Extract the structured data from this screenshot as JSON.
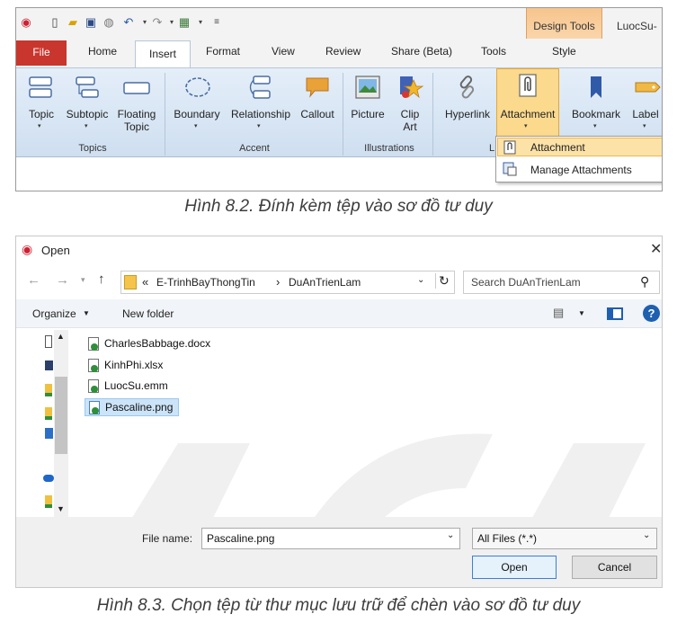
{
  "ribbon": {
    "context_tab_group": "Design Tools",
    "context_tab": "Style",
    "doc_title": "LuocSu-",
    "tabs": [
      "File",
      "Home",
      "Insert",
      "Format",
      "View",
      "Review",
      "Share (Beta)",
      "Tools"
    ],
    "buttons": {
      "topic": "Topic",
      "subtopic": "Subtopic",
      "floating1": "Floating",
      "floating2": "Topic",
      "boundary": "Boundary",
      "relationship": "Relationship",
      "callout": "Callout",
      "picture": "Picture",
      "clip1": "Clip",
      "clip2": "Art",
      "hyperlink": "Hyperlink",
      "attachment": "Attachment",
      "bookmark": "Bookmark",
      "label": "Label"
    },
    "groups": {
      "topics": "Topics",
      "accent": "Accent",
      "illustrations": "Illustrations",
      "links": "L"
    },
    "menu": [
      "Attachment",
      "Manage Attachments"
    ]
  },
  "captions": {
    "fig1": "Hình 8.2. Đính kèm tệp vào sơ đồ tư duy",
    "fig2": "Hình 8.3. Chọn tệp từ thư mục lưu trữ để chèn vào sơ đồ tư duy"
  },
  "dialog": {
    "title": "Open",
    "close": "✕",
    "path_prefix": "«",
    "path1": "E-TrinhBayThongTin",
    "path_sep": "›",
    "path2": "DuAnTrienLam",
    "search_placeholder": "Search DuAnTrienLam",
    "organize": "Organize",
    "new_folder": "New folder",
    "files": [
      "CharlesBabbage.docx",
      "KinhPhi.xlsx",
      "LuocSu.emm",
      "Pascaline.png"
    ],
    "file_name_label": "File name:",
    "file_name_value": "Pascaline.png",
    "filter": "All Files (*.*)",
    "open": "Open",
    "cancel": "Cancel"
  },
  "colors": {
    "file_tab": "#c8362d",
    "highlight": "#fbd98d",
    "accent_blue": "#1e5fb0"
  }
}
